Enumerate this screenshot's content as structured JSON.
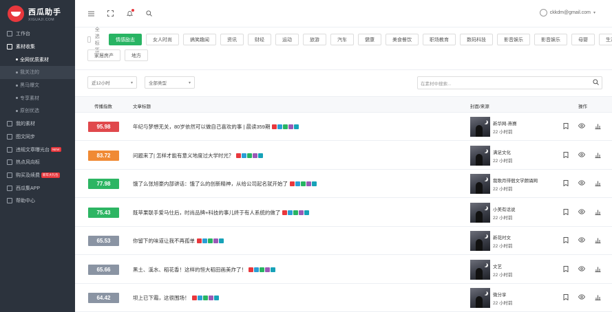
{
  "logo": {
    "title": "西瓜助手",
    "subtitle": "XIGUAJI.COM"
  },
  "sidebar": {
    "items": [
      {
        "label": "工作台",
        "icon": "dashboard-icon"
      },
      {
        "label": "素材收集",
        "icon": "folder-icon",
        "active": true
      },
      {
        "label": "我的素材",
        "icon": "file-icon"
      },
      {
        "label": "图文同步",
        "icon": "sync-icon"
      },
      {
        "label": "违规文章曝光台",
        "icon": "warning-icon",
        "badge": "NEW"
      },
      {
        "label": "热点风向标",
        "icon": "flag-icon"
      },
      {
        "label": "购买及续费",
        "icon": "cart-icon",
        "badge": "新年大礼包"
      },
      {
        "label": "西瓜集APP",
        "icon": "phone-icon"
      },
      {
        "label": "帮助中心",
        "icon": "help-icon"
      }
    ],
    "subitems": [
      {
        "label": "全网优质素材",
        "selected": true
      },
      {
        "label": "我关注的",
        "highlighted": true
      },
      {
        "label": "黑马爆文"
      },
      {
        "label": "专享素材"
      },
      {
        "label": "原创优选"
      }
    ]
  },
  "header": {
    "user_email": "ckkdm@gmail.com"
  },
  "tags": {
    "check_all": "全选标签",
    "row1": [
      "情感励志",
      "女人时尚",
      "搞笑趣闻",
      "资讯",
      "财经",
      "运动",
      "旅游",
      "汽车",
      "健康",
      "美食餐饮",
      "职场教育",
      "数码科技",
      "影音娱乐",
      "影音娱乐",
      "母婴",
      "生活"
    ],
    "row2": [
      "家居房产",
      "地方"
    ],
    "active": "情感励志"
  },
  "filters": {
    "time": "近12小时",
    "type": "全部类型",
    "search_placeholder": "在素材中搜索..."
  },
  "table": {
    "headers": {
      "score": "传播指数",
      "title": "文章标题",
      "source": "封面/来源",
      "actions": "操作"
    },
    "rows": [
      {
        "score": "95.98",
        "color": "#e0484c",
        "title": "年纪与梦想无关，80岁依然可以做自己喜欢的事 | 晨读359期",
        "source": "新华网-燕赛",
        "time": "22 小时前"
      },
      {
        "score": "83.72",
        "color": "#f08a34",
        "title": "问题来了| 怎样才能有意义地度过大学时光？",
        "source": "满足文化",
        "time": "22 小时前"
      },
      {
        "score": "77.98",
        "color": "#2db563",
        "title": "饿了么张旭豪内部讲话：饿了么的创新精神，从给公司起名就开始了",
        "source": "我歌月徘徊文学朗诵网",
        "time": "22 小时前"
      },
      {
        "score": "75.43",
        "color": "#2db563",
        "title": "既苹果联手爱马仕后，时尚品牌+科技的事儿终于有人系统的做了",
        "source": "小美有话说",
        "time": "22 小时前"
      },
      {
        "score": "65.53",
        "color": "#8a94a3",
        "title": "你留下的味道让我不再孤单",
        "source": "新花时文",
        "time": "22 小时前"
      },
      {
        "score": "65.66",
        "color": "#8a94a3",
        "title": "黑土、溪水、稻花香！这样的恒大稻田画美炸了！",
        "source": "文艺",
        "time": "22 小时前"
      },
      {
        "score": "64.42",
        "color": "#8a94a3",
        "title": "坝上已下霜，这很围场！",
        "source": "微分享",
        "time": "22 小时前"
      }
    ]
  },
  "colors": {
    "accent": "#28b463",
    "sidebar_bg": "#2c333d",
    "brand": "#e8383d"
  }
}
